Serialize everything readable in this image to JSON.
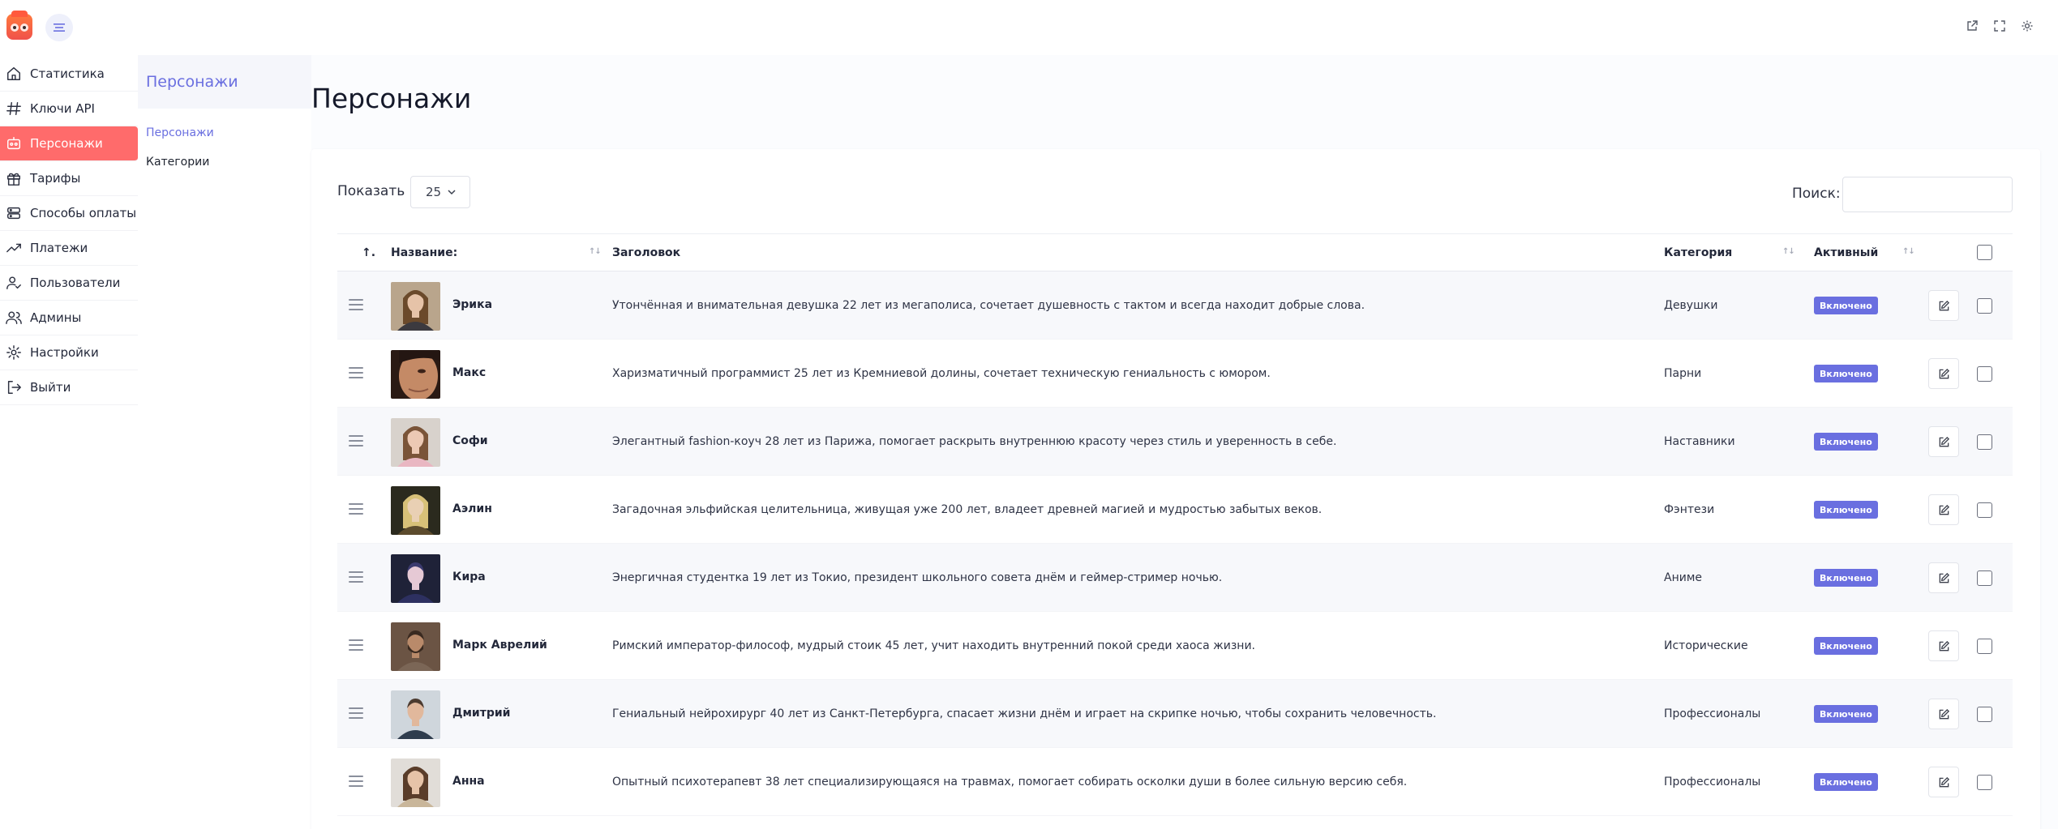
{
  "colors": {
    "accent": "#6a6fe0",
    "active_nav": "#ff6b6b",
    "logo": "#f0524a",
    "badge": "#6a6fe0"
  },
  "topbar": {
    "icons": [
      "menu-icon",
      "external-link-icon",
      "fullscreen-icon",
      "gear-icon"
    ]
  },
  "sidebar": {
    "items": [
      {
        "label": "Статистика",
        "icon": "home-icon"
      },
      {
        "label": "Ключи API",
        "icon": "hash-icon"
      },
      {
        "label": "Персонажи",
        "icon": "robot-icon",
        "active": true
      },
      {
        "label": "Тарифы",
        "icon": "gift-icon"
      },
      {
        "label": "Способы оплаты",
        "icon": "server-icon"
      },
      {
        "label": "Платежи",
        "icon": "trending-up-icon"
      },
      {
        "label": "Пользователи",
        "icon": "user-check-icon"
      },
      {
        "label": "Админы",
        "icon": "users-icon"
      },
      {
        "label": "Настройки",
        "icon": "gear-icon"
      },
      {
        "label": "Выйти",
        "icon": "logout-icon"
      }
    ]
  },
  "subsidebar": {
    "title": "Персонажи",
    "items": [
      {
        "label": "Персонажи",
        "active": true
      },
      {
        "label": "Категории"
      }
    ]
  },
  "main": {
    "title": "Персонажи",
    "show_label": "Показать",
    "page_size": "25",
    "search_label": "Поиск:",
    "search_value": ""
  },
  "table": {
    "columns": {
      "order": "↑.",
      "name": "Название:",
      "headline": "Заголовок",
      "category": "Категория",
      "active": "Активный"
    },
    "rows": [
      {
        "name": "Эрика",
        "headline": "Утончённая и внимательная девушка 22 лет из мегаполиса, сочетает душевность с тактом и всегда находит добрые слова.",
        "category": "Девушки",
        "status": "Включено",
        "avatar": "avatar-woman-blonde"
      },
      {
        "name": "Макс",
        "headline": "Харизматичный программист 25 лет из Кремниевой долины, сочетает техническую гениальность с юмором.",
        "category": "Парни",
        "status": "Включено",
        "avatar": "avatar-man-closeup"
      },
      {
        "name": "Софи",
        "headline": "Элегантный fashion-коуч 28 лет из Парижа, помогает раскрыть внутреннюю красоту через стиль и уверенность в себе.",
        "category": "Наставники",
        "status": "Включено",
        "avatar": "avatar-woman-pink"
      },
      {
        "name": "Аэлин",
        "headline": "Загадочная эльфийская целительница, живущая уже 200 лет, владеет древней магией и мудростью забытых веков.",
        "category": "Фэнтези",
        "status": "Включено",
        "avatar": "avatar-elf"
      },
      {
        "name": "Кира",
        "headline": "Энергичная студентка 19 лет из Токио, президент школьного совета днём и геймер-стример ночью.",
        "category": "Аниме",
        "status": "Включено",
        "avatar": "avatar-anime"
      },
      {
        "name": "Марк Аврелий",
        "headline": "Римский император-философ, мудрый стоик 45 лет, учит находить внутренний покой среди хаоса жизни.",
        "category": "Исторические",
        "status": "Включено",
        "avatar": "avatar-roman"
      },
      {
        "name": "Дмитрий",
        "headline": "Гениальный нейрохирург 40 лет из Санкт-Петербурга, спасает жизни днём и играет на скрипке ночью, чтобы сохранить человечность.",
        "category": "Профессионалы",
        "status": "Включено",
        "avatar": "avatar-man-suit"
      },
      {
        "name": "Анна",
        "headline": "Опытный психотерапевт 38 лет специализирующаяся на травмах, помогает собирать осколки души в более сильную версию себя.",
        "category": "Профессионалы",
        "status": "Включено",
        "avatar": "avatar-woman-therapist"
      }
    ]
  }
}
